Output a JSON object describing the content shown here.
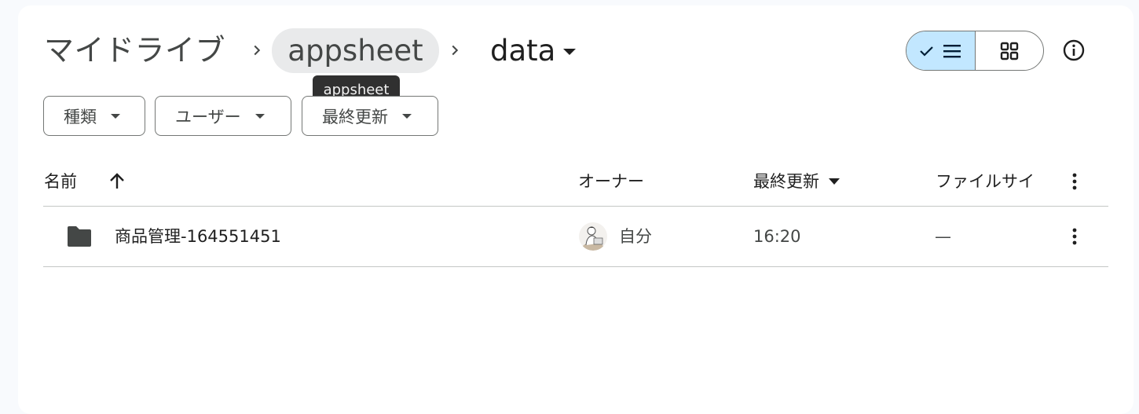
{
  "breadcrumb": {
    "root": "マイドライブ",
    "middle": "appsheet",
    "current": "data",
    "tooltip": "appsheet"
  },
  "filters": [
    "種類",
    "ユーザー",
    "最終更新"
  ],
  "columns": {
    "name": "名前",
    "owner": "オーナー",
    "modified": "最終更新",
    "size": "ファイルサイ"
  },
  "rows": [
    {
      "name": "商品管理-164551451",
      "owner": "自分",
      "modified": "16:20",
      "size": "—"
    }
  ],
  "icons": {
    "view_list": "checkmark-list-icon",
    "view_grid": "grid-icon",
    "info": "info-icon",
    "folder": "folder-icon",
    "sort": "arrow-up-icon"
  },
  "colors": {
    "toggle_active": "#c2e7ff",
    "tooltip_bg": "#303030",
    "folder": "#444746"
  }
}
